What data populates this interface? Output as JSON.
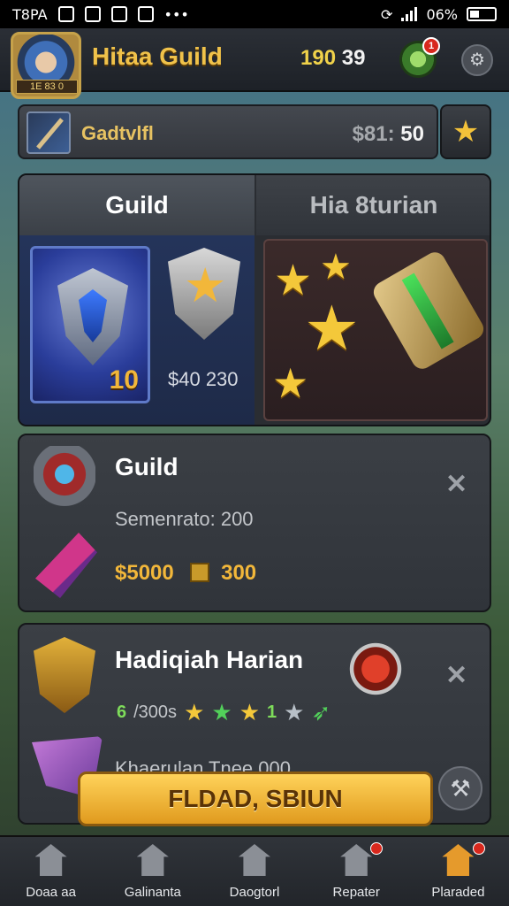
{
  "status_bar": {
    "carrier": "T8PA",
    "battery_percent": "06%"
  },
  "header": {
    "guild_name": "Hitaa Guild",
    "avatar_level": "1E 83 0",
    "currency_a": "190",
    "currency_b": "39",
    "notification_count": "1"
  },
  "banner": {
    "label": "Gadtvlfl",
    "value_dim": "$81:",
    "value_main": "50"
  },
  "tabs": [
    {
      "label": "Guild"
    },
    {
      "label": "Hia 8turian"
    }
  ],
  "guild_panel": {
    "emblem_level": "10",
    "price": "$40 230"
  },
  "cards": [
    {
      "title": "Guild",
      "subtitle": "Semenrato: 200",
      "price_a": "$5000",
      "price_b": "300"
    },
    {
      "title": "Hadiqiah Harian",
      "reward_count": "6",
      "reward_time": "/300s",
      "reward_extra": "1",
      "footer_text": "Khaerulan Tnee 000"
    }
  ],
  "cta": {
    "label": "FLDAD, SBIUN"
  },
  "bottom_nav": [
    {
      "label": "Doaa aa"
    },
    {
      "label": "Galinanta"
    },
    {
      "label": "Daogtorl"
    },
    {
      "label": "Repater"
    },
    {
      "label": "Plaraded"
    }
  ],
  "colors": {
    "gold": "#f2b73a",
    "accent_orange": "#e59a2c",
    "alert_red": "#d8281d"
  }
}
